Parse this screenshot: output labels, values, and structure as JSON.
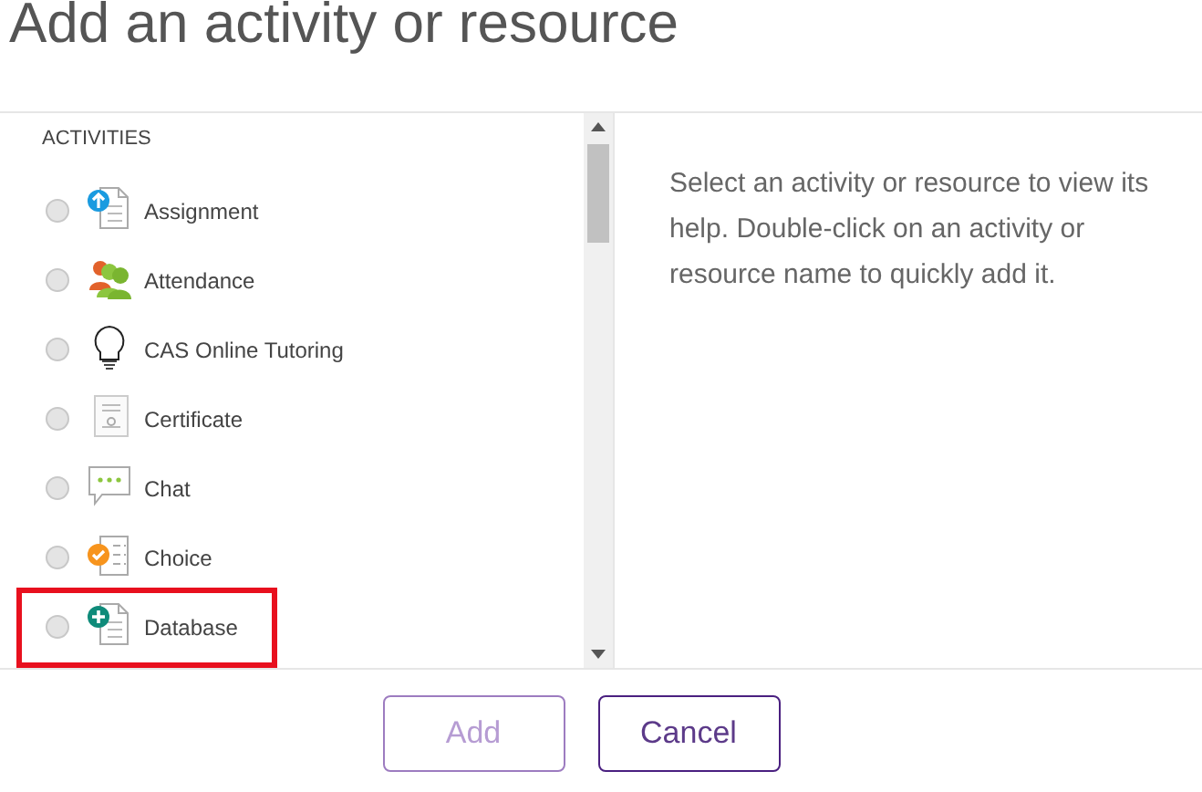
{
  "dialog": {
    "title": "Add an activity or resource"
  },
  "section_heading": "ACTIVITIES",
  "items": [
    {
      "label": "Assignment",
      "selected": false,
      "highlighted": false
    },
    {
      "label": "Attendance",
      "selected": false,
      "highlighted": false
    },
    {
      "label": "CAS Online Tutoring",
      "selected": false,
      "highlighted": false
    },
    {
      "label": "Certificate",
      "selected": false,
      "highlighted": false
    },
    {
      "label": "Chat",
      "selected": false,
      "highlighted": false
    },
    {
      "label": "Choice",
      "selected": false,
      "highlighted": false
    },
    {
      "label": "Database",
      "selected": false,
      "highlighted": true
    }
  ],
  "help_text": "Select an activity or resource to view its help. Double-click on an activity or resource name to quickly add it.",
  "buttons": [
    {
      "label": "Add",
      "disabled": true
    },
    {
      "label": "Cancel",
      "disabled": false
    }
  ]
}
